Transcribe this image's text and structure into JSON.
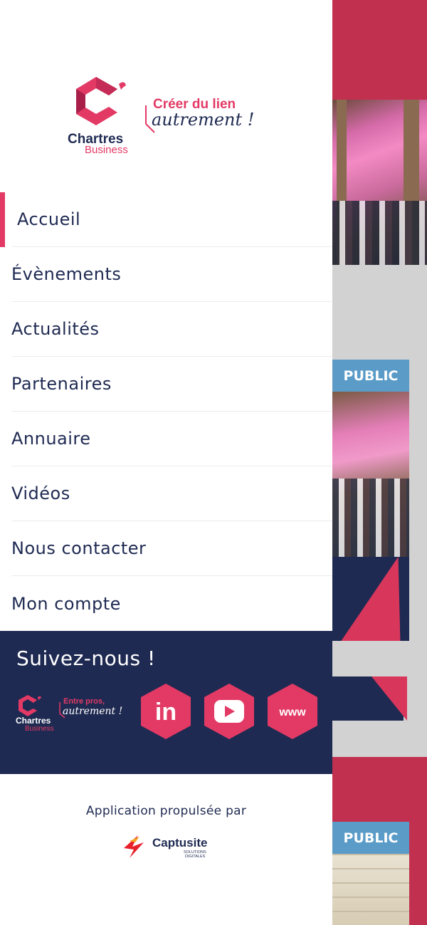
{
  "brand": {
    "name_line1": "Chartres",
    "name_line2": "Business",
    "tagline_line1": "Créer du lien",
    "tagline_line2": "autrement !"
  },
  "nav": {
    "items": [
      {
        "label": "Accueil",
        "active": true
      },
      {
        "label": "Évènements"
      },
      {
        "label": "Actualités"
      },
      {
        "label": "Partenaires"
      },
      {
        "label": "Annuaire"
      },
      {
        "label": "Vidéos"
      },
      {
        "label": "Nous contacter"
      },
      {
        "label": "Mon compte"
      }
    ]
  },
  "follow": {
    "title": "Suivez-nous !",
    "logo_line1": "Chartres",
    "logo_line2": "Business",
    "logo_tag1": "Entre pros,",
    "logo_tag2": "autrement !",
    "social": [
      {
        "icon": "linkedin-icon",
        "label": "in"
      },
      {
        "icon": "youtube-icon",
        "label": ""
      },
      {
        "icon": "website-icon",
        "label": "www"
      }
    ]
  },
  "footer": {
    "powered_by": "Application propulsée par",
    "provider": "Captusite",
    "provider_sub1": "SOLUTIONS",
    "provider_sub2": "DIGITALES"
  },
  "background": {
    "badge1": "PUBLIC",
    "badge2": "PUBLIC"
  },
  "colors": {
    "navy": "#1f2a52",
    "accent": "#e23a65",
    "badge": "#5a9bc7"
  }
}
